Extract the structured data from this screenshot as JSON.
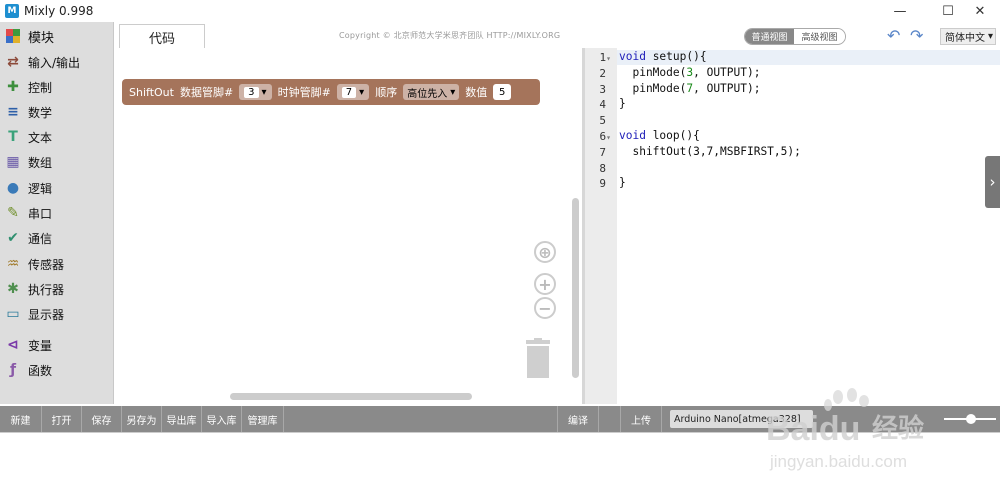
{
  "window": {
    "title": "Mixly 0.998",
    "icon": "mixly-app-icon"
  },
  "sidebar": {
    "header": "模块",
    "items": [
      {
        "label": "输入/输出",
        "icon": "io-arrows-icon",
        "color": "#8c4a3a"
      },
      {
        "label": "控制",
        "icon": "gamepad-icon",
        "color": "#3d8f3d"
      },
      {
        "label": "数学",
        "icon": "math-icon",
        "color": "#2d5fa8"
      },
      {
        "label": "文本",
        "icon": "text-icon",
        "color": "#3aa27a"
      },
      {
        "label": "数组",
        "icon": "array-icon",
        "color": "#6a5aa8"
      },
      {
        "label": "逻辑",
        "icon": "bulb-icon",
        "color": "#3a7ab8"
      },
      {
        "label": "串口",
        "icon": "pen-icon",
        "color": "#6f8f2a"
      },
      {
        "label": "通信",
        "icon": "comm-icon",
        "color": "#2f8f6f"
      },
      {
        "label": "传感器",
        "icon": "sensor-icon",
        "color": "#a07a2a"
      },
      {
        "label": "执行器",
        "icon": "actuator-icon",
        "color": "#4f8f4f"
      },
      {
        "label": "显示器",
        "icon": "monitor-icon",
        "color": "#2a7a9a"
      },
      {
        "label": "变量",
        "icon": "variable-icon",
        "color": "#7a3aa8"
      },
      {
        "label": "函数",
        "icon": "function-icon",
        "color": "#8a5aa8"
      }
    ]
  },
  "tabs": {
    "code_label": "代码"
  },
  "header": {
    "copyright": "Copyright © 北京师范大学米思齐团队 HTTP://MIXLY.ORG",
    "view_normal": "普通视图",
    "view_advanced": "高级视图",
    "language": "简体中文",
    "language_caret": "▾"
  },
  "block": {
    "name": "ShiftOut",
    "data_pin_label": "数据管脚#",
    "data_pin": "3",
    "clock_pin_label": "时钟管脚#",
    "clock_pin": "7",
    "order_label": "顺序",
    "order": "高位先入",
    "value_label": "数值",
    "value": "5",
    "caret": "▾",
    "color": "#a5745b"
  },
  "workspace_controls": {
    "center_symbol": "⊕",
    "zoom_in_symbol": "+",
    "zoom_out_symbol": "−"
  },
  "code": {
    "line_numbers": [
      "1",
      "2",
      "3",
      "4",
      "5",
      "6",
      "7",
      "8",
      "9"
    ],
    "fold_marks": [
      "▾",
      "",
      "",
      "",
      "",
      "▾",
      "",
      "",
      ""
    ],
    "lines": [
      [
        {
          "t": "void",
          "k": "kw"
        },
        {
          "t": " setup(){",
          "k": ""
        }
      ],
      [
        {
          "t": "  pinMode(",
          "k": ""
        },
        {
          "t": "3",
          "k": "num"
        },
        {
          "t": ", OUTPUT);",
          "k": ""
        }
      ],
      [
        {
          "t": "  pinMode(",
          "k": ""
        },
        {
          "t": "7",
          "k": "num"
        },
        {
          "t": ", OUTPUT);",
          "k": ""
        }
      ],
      [
        {
          "t": "}",
          "k": ""
        }
      ],
      [
        {
          "t": "",
          "k": ""
        }
      ],
      [
        {
          "t": "void",
          "k": "kw"
        },
        {
          "t": " loop(){",
          "k": ""
        }
      ],
      [
        {
          "t": "  shiftOut(3,7,MSBFIRST,5);",
          "k": ""
        }
      ],
      [
        {
          "t": "",
          "k": ""
        }
      ],
      [
        {
          "t": "}",
          "k": ""
        }
      ]
    ],
    "side_handle": "›"
  },
  "toolbar": {
    "new": "新建",
    "open": "打开",
    "save": "保存",
    "save_as": "另存为",
    "export_lib": "导出库",
    "import_lib": "导入库",
    "manage_lib": "管理库",
    "compile": "编译",
    "upload": "上传",
    "board": "Arduino Nano[atmega328]"
  },
  "watermark": {
    "brand": "Baidu",
    "brand_suffix": "经验",
    "url": "jingyan.baidu.com"
  }
}
